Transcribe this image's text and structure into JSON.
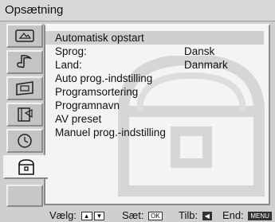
{
  "header": {
    "title": "Opsætning"
  },
  "sidebar": {
    "items": [
      {
        "icon": "picture-icon"
      },
      {
        "icon": "sound-icon"
      },
      {
        "icon": "screen-icon"
      },
      {
        "icon": "features-icon"
      },
      {
        "icon": "timer-icon"
      },
      {
        "icon": "toolbox-icon",
        "active": true
      }
    ]
  },
  "menu": {
    "items": [
      {
        "label": "Automatisk opstart",
        "value": ""
      },
      {
        "label": "Sprog:",
        "value": "Dansk"
      },
      {
        "label": "Land:",
        "value": "Danmark"
      },
      {
        "label": "Auto prog.-indstilling",
        "value": ""
      },
      {
        "label": "Programsortering",
        "value": ""
      },
      {
        "label": "Programnavn",
        "value": ""
      },
      {
        "label": "AV preset",
        "value": ""
      },
      {
        "label": "Manuel prog.-indstilling",
        "value": ""
      }
    ]
  },
  "footer": {
    "select_label": "Vælg:",
    "set_label": "Sæt:",
    "set_key": "OK",
    "back_label": "Tilb:",
    "end_label": "End:",
    "end_key": "MENU"
  }
}
